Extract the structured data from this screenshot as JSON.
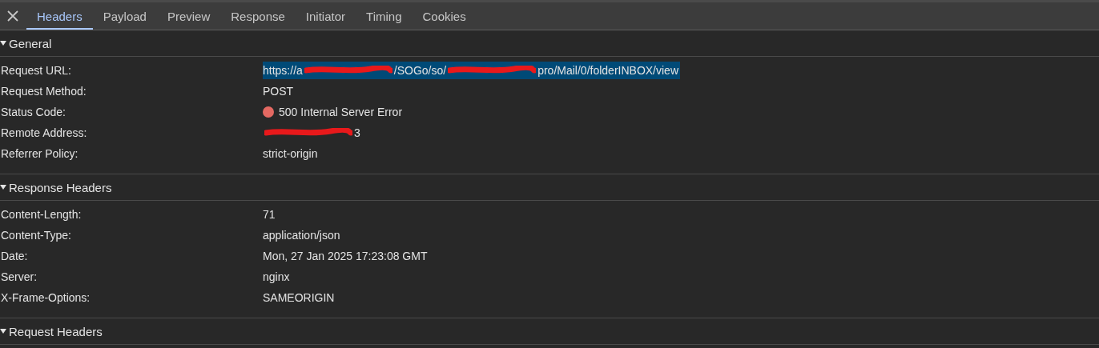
{
  "tabs": [
    {
      "label": "Headers",
      "selected": true
    },
    {
      "label": "Payload",
      "selected": false
    },
    {
      "label": "Preview",
      "selected": false
    },
    {
      "label": "Response",
      "selected": false
    },
    {
      "label": "Initiator",
      "selected": false
    },
    {
      "label": "Timing",
      "selected": false
    },
    {
      "label": "Cookies",
      "selected": false
    }
  ],
  "sections": [
    {
      "title": "General",
      "expanded": true,
      "rows": [
        {
          "name": "Request URL:",
          "highlighted": true,
          "value_parts": [
            {
              "kind": "text",
              "text": "https://a"
            },
            {
              "kind": "redaction"
            },
            {
              "kind": "text",
              "text": "/SOGo/so/"
            },
            {
              "kind": "redaction"
            },
            {
              "kind": "text",
              "text": "pro/Mail/0/folderINBOX/view"
            }
          ]
        },
        {
          "name": "Request Method:",
          "highlighted": false,
          "value_parts": [
            {
              "kind": "text",
              "text": "POST"
            }
          ]
        },
        {
          "name": "Status Code:",
          "highlighted": false,
          "color": "#e46962",
          "value_parts": [
            {
              "kind": "text",
              "text": "500 Internal Server Error"
            }
          ]
        },
        {
          "name": "Remote Address:",
          "highlighted": false,
          "value_parts": [
            {
              "kind": "redaction"
            },
            {
              "kind": "text",
              "text": "3"
            }
          ]
        },
        {
          "name": "Referrer Policy:",
          "highlighted": false,
          "value_parts": [
            {
              "kind": "text",
              "text": "strict-origin"
            }
          ]
        }
      ]
    },
    {
      "title": "Response Headers",
      "expanded": true,
      "rows": [
        {
          "name": "Content-Length:",
          "highlighted": false,
          "value_parts": [
            {
              "kind": "text",
              "text": "71"
            }
          ]
        },
        {
          "name": "Content-Type:",
          "highlighted": false,
          "value_parts": [
            {
              "kind": "text",
              "text": "application/json"
            }
          ]
        },
        {
          "name": "Date:",
          "highlighted": false,
          "value_parts": [
            {
              "kind": "text",
              "text": "Mon, 27 Jan 2025 17:23:08 GMT"
            }
          ]
        },
        {
          "name": "Server:",
          "highlighted": false,
          "value_parts": [
            {
              "kind": "text",
              "text": "nginx"
            }
          ]
        },
        {
          "name": "X-Frame-Options:",
          "highlighted": false,
          "value_parts": [
            {
              "kind": "text",
              "text": "SAMEORIGIN"
            }
          ]
        }
      ]
    },
    {
      "title": "Request Headers",
      "expanded": true
    }
  ]
}
